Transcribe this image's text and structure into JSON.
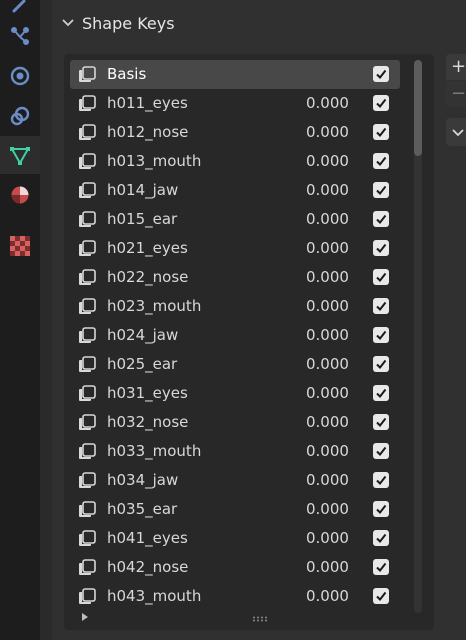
{
  "panel": {
    "title": "Shape Keys"
  },
  "tabs": [
    {
      "name": "tool-icon",
      "active": false
    },
    {
      "name": "particles-icon",
      "active": false
    },
    {
      "name": "physics-icon",
      "active": false
    },
    {
      "name": "constraints-icon",
      "active": false
    },
    {
      "name": "object-data-icon",
      "active": true
    },
    {
      "name": "material-icon",
      "active": false
    },
    {
      "name": "texture-icon",
      "active": false
    }
  ],
  "shape_keys": [
    {
      "name": "Basis",
      "value": "",
      "checked": true,
      "selected": true
    },
    {
      "name": "h011_eyes",
      "value": "0.000",
      "checked": true
    },
    {
      "name": "h012_nose",
      "value": "0.000",
      "checked": true
    },
    {
      "name": "h013_mouth",
      "value": "0.000",
      "checked": true
    },
    {
      "name": "h014_jaw",
      "value": "0.000",
      "checked": true
    },
    {
      "name": "h015_ear",
      "value": "0.000",
      "checked": true
    },
    {
      "name": "h021_eyes",
      "value": "0.000",
      "checked": true
    },
    {
      "name": "h022_nose",
      "value": "0.000",
      "checked": true
    },
    {
      "name": "h023_mouth",
      "value": "0.000",
      "checked": true
    },
    {
      "name": "h024_jaw",
      "value": "0.000",
      "checked": true
    },
    {
      "name": "h025_ear",
      "value": "0.000",
      "checked": true
    },
    {
      "name": "h031_eyes",
      "value": "0.000",
      "checked": true
    },
    {
      "name": "h032_nose",
      "value": "0.000",
      "checked": true
    },
    {
      "name": "h033_mouth",
      "value": "0.000",
      "checked": true
    },
    {
      "name": "h034_jaw",
      "value": "0.000",
      "checked": true
    },
    {
      "name": "h035_ear",
      "value": "0.000",
      "checked": true
    },
    {
      "name": "h041_eyes",
      "value": "0.000",
      "checked": true
    },
    {
      "name": "h042_nose",
      "value": "0.000",
      "checked": true
    },
    {
      "name": "h043_mouth",
      "value": "0.000",
      "checked": true
    }
  ],
  "buttons": {
    "add": "+",
    "remove": "−"
  },
  "colors": {
    "accent_active_tab": "#3fd0a6",
    "checkbox_fill": "#e8e8e8",
    "selected_row": "#484848"
  }
}
